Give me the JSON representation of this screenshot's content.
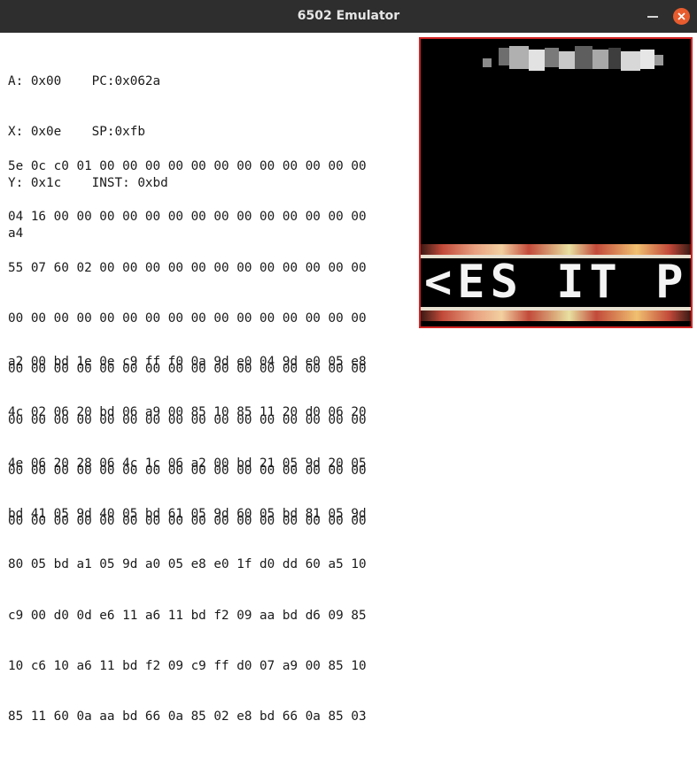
{
  "window": {
    "title": "6502 Emulator"
  },
  "registers": [
    "A: 0x00    PC:0x062a",
    "X: 0x0e    SP:0xfb",
    "Y: 0x1c    INST: 0xbd",
    "a4"
  ],
  "memory_rows": [
    "5e 0c c0 01 00 00 00 00 00 00 00 00 00 00 00 00",
    "04 16 00 00 00 00 00 00 00 00 00 00 00 00 00 00",
    "55 07 60 02 00 00 00 00 00 00 00 00 00 00 00 00",
    "00 00 00 00 00 00 00 00 00 00 00 00 00 00 00 00",
    "00 00 00 00 00 00 00 00 00 00 00 00 00 00 00 00",
    "00 00 00 00 00 00 00 00 00 00 00 00 00 00 00 00",
    "00 00 00 00 00 00 00 00 00 00 00 00 00 00 00 00",
    "00 00 00 00 00 00 00 00 00 00 00 00 00 00 00 00"
  ],
  "program_rows": [
    "a2 00 bd 1e 0e c9 ff f0 0a 9d e0 04 9d e0 05 e8",
    "4c 02 06 20 bd 06 a9 00 85 10 85 11 20 d0 06 20",
    "4e 06 20 28 06 4c 1c 06 a2 00 bd 21 05 9d 20 05",
    "bd 41 05 9d 40 05 bd 61 05 9d 60 05 bd 81 05 9d",
    "80 05 bd a1 05 9d a0 05 e8 e0 1f d0 dd 60 a5 10",
    "c9 00 d0 0d e6 11 a6 11 bd f2 09 aa bd d6 09 85",
    "10 c6 10 a6 11 bd f2 09 c9 ff d0 07 a9 00 85 10",
    "85 11 60 0a aa bd 66 0a 85 02 e8 bd 66 0a 85 03"
  ],
  "screen": {
    "banner_text": "<ES IT P"
  },
  "colors": {
    "titlebar": "#2e2e2e",
    "close": "#e85c2e",
    "screen_border": "#d42424",
    "screen_bg": "#000000"
  },
  "icons": {
    "minimize": "minimize-icon",
    "close": "close-icon"
  }
}
